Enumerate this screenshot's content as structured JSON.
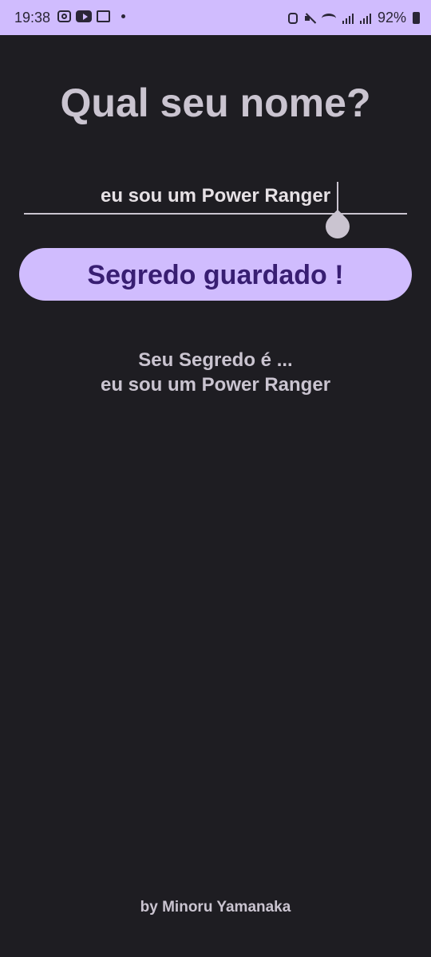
{
  "status_bar": {
    "time": "19:38",
    "battery": "92%",
    "icons_left": [
      "instagram-icon",
      "youtube-icon",
      "cast-icon",
      "notification-dot"
    ],
    "icons_right": [
      "alarm-icon",
      "mute-icon",
      "wifi-icon",
      "signal-icon",
      "signal-icon",
      "battery-icon"
    ],
    "background": "#d0bcfe"
  },
  "main": {
    "title": "Qual seu nome?",
    "input": {
      "value": "eu sou um Power Ranger"
    },
    "save_button_label": "Segredo guardado !",
    "secret_heading": "Seu Segredo é ...",
    "secret_value": "eu sou um Power Ranger",
    "footer": "by Minoru Yamanaka"
  },
  "colors": {
    "background": "#1e1d22",
    "accent": "#d0bcfe",
    "button_text": "#381e72",
    "text": "#cac4d0"
  }
}
